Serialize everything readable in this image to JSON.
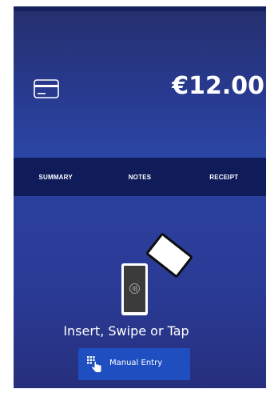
{
  "payment": {
    "amount": "€12.00",
    "prompt": "Insert, Swipe or Tap"
  },
  "tabs": [
    {
      "label": "SUMMARY"
    },
    {
      "label": "NOTES"
    },
    {
      "label": "RECEIPT"
    }
  ],
  "manual_entry": {
    "label": "Manual Entry"
  },
  "icons": {
    "card": "credit-card-icon",
    "contactless": "contactless-icon",
    "keypad": "keypad-hand-icon"
  },
  "colors": {
    "header": "#283a8f",
    "tab_bar": "#101c5a",
    "content": "#2a3b95",
    "button": "#1f4ec0"
  }
}
